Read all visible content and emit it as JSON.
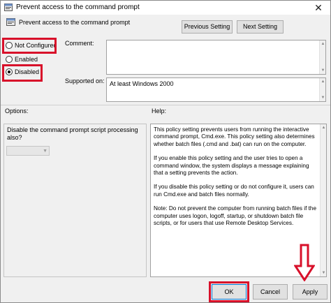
{
  "window": {
    "title": "Prevent access to the command prompt",
    "close_glyph": "✕"
  },
  "header": {
    "policy_title": "Prevent access to the command prompt",
    "previous_label": "Previous Setting",
    "next_label": "Next Setting"
  },
  "state": {
    "options": [
      {
        "label": "Not Configured",
        "checked": false
      },
      {
        "label": "Enabled",
        "checked": false
      },
      {
        "label": "Disabled",
        "checked": true
      }
    ]
  },
  "comment": {
    "label": "Comment:",
    "value": ""
  },
  "supported": {
    "label": "Supported on:",
    "value": "At least Windows 2000"
  },
  "options_panel": {
    "label": "Options:",
    "text": "Disable the command prompt script processing also?",
    "select_value": ""
  },
  "help_panel": {
    "label": "Help:",
    "paragraphs": [
      "This policy setting prevents users from running the interactive command prompt, Cmd.exe.  This policy setting also determines whether batch files (.cmd and .bat) can run on the computer.",
      "If you enable this policy setting and the user tries to open a command window, the system displays a message explaining that a setting prevents the action.",
      "If you disable this policy setting or do not configure it, users can run Cmd.exe and batch files normally.",
      "Note: Do not prevent the computer from running batch files if the computer uses logon, logoff, startup, or shutdown batch file scripts, or for users that use Remote Desktop Services."
    ]
  },
  "footer": {
    "ok_label": "OK",
    "cancel_label": "Cancel",
    "apply_label": "Apply"
  },
  "annotation": {
    "highlight_color": "#d8102a",
    "arrow_icon": "down-arrow-icon"
  }
}
